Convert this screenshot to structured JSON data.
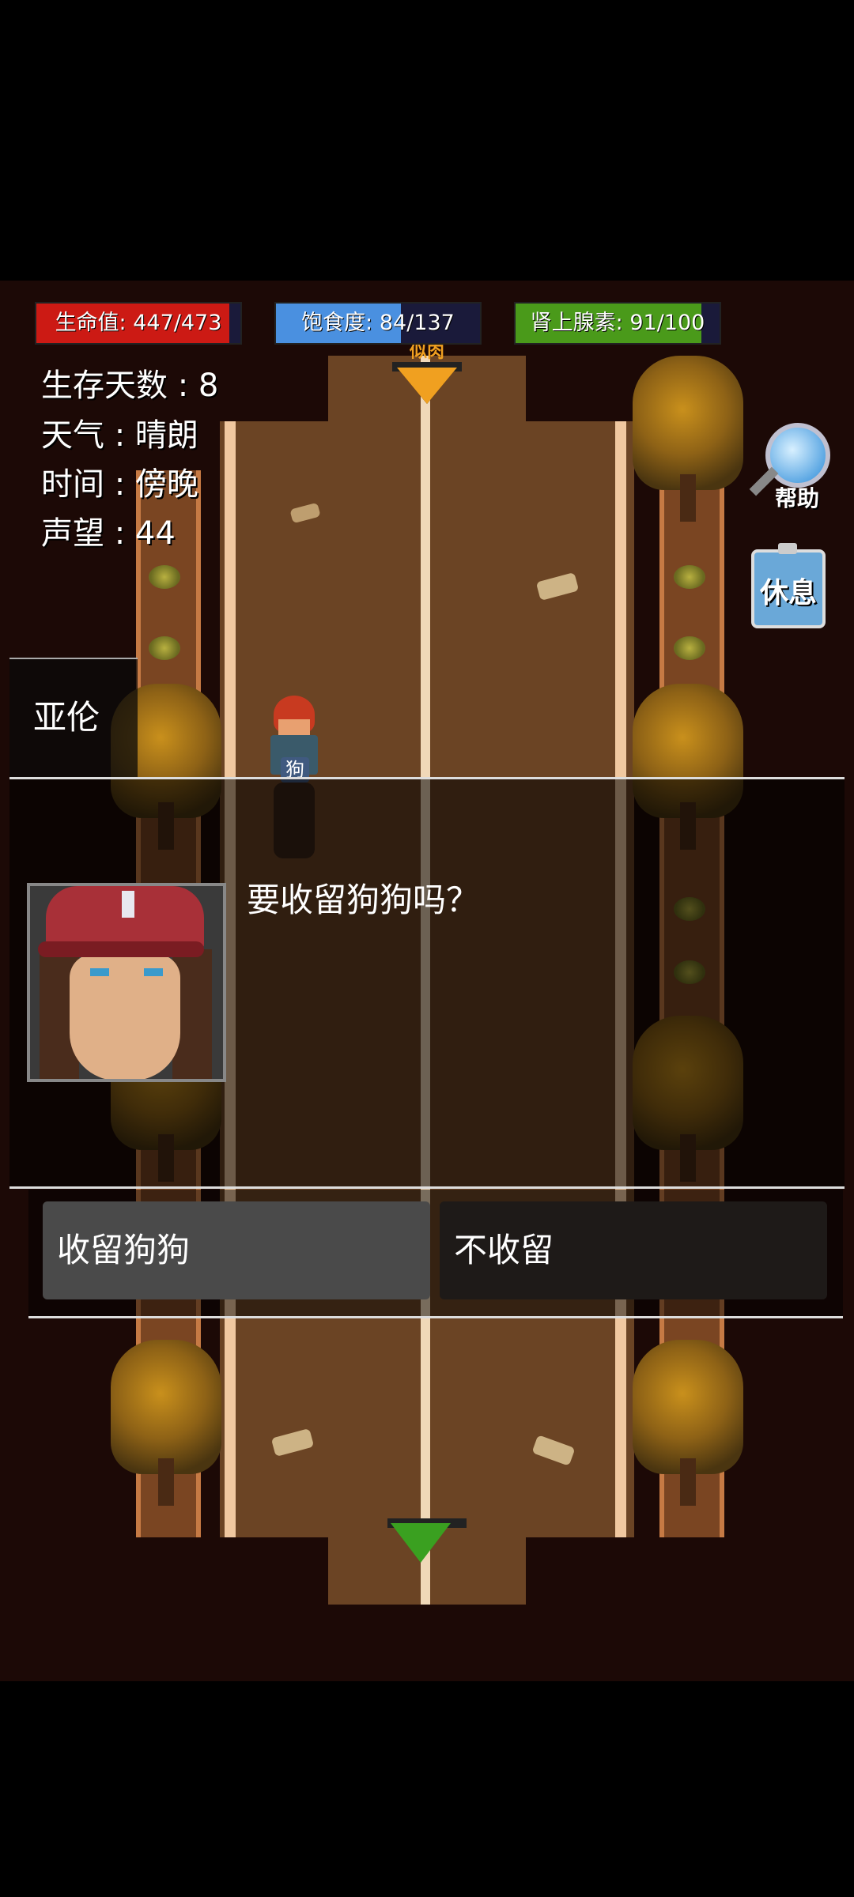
{
  "hud": {
    "life": {
      "label": "生命值: 447/473",
      "current": 447,
      "max": 473,
      "color": "#cc1a14"
    },
    "food": {
      "label": "饱食度: 84/137",
      "current": 84,
      "max": 137,
      "color": "#4a90e0"
    },
    "adrenaline": {
      "label": "肾上腺素: 91/100",
      "current": 91,
      "max": 100,
      "color": "#4a9a1a"
    }
  },
  "info": {
    "days": "生存天数 : 8",
    "weather": "天气 : 晴朗",
    "time": "时间 : 傍晚",
    "reputation": "声望 : 44"
  },
  "buttons": {
    "help": "帮助",
    "rest": "休息"
  },
  "map": {
    "top_exit_label": "似肉",
    "dog_label": "狗"
  },
  "dialog": {
    "speaker": "亚伦",
    "text": "要收留狗狗吗？",
    "choices": [
      "收留狗狗",
      "不收留"
    ]
  }
}
